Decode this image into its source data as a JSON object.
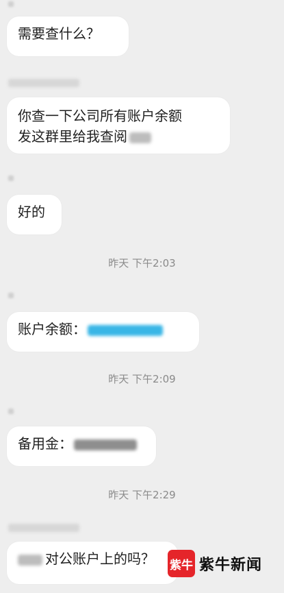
{
  "messages": [
    {
      "text": "需要查什么？"
    },
    {
      "lines": [
        "你查一下公司所有账户余额",
        "发这群里给我查阅"
      ]
    },
    {
      "text": "好的"
    },
    {
      "label": "账户余额："
    },
    {
      "label": "备用金："
    },
    {
      "text": "对公账户上的吗？"
    }
  ],
  "timestamps": [
    "昨天  下午2:03",
    "昨天  下午2:09",
    "昨天  下午2:29"
  ],
  "watermark": {
    "mark": "紫牛",
    "text": "紫牛新闻"
  },
  "colors": {
    "background": "#eeeeee",
    "bubble": "#ffffff",
    "link": "#39b6e6",
    "brand_red": "#e5252a"
  }
}
